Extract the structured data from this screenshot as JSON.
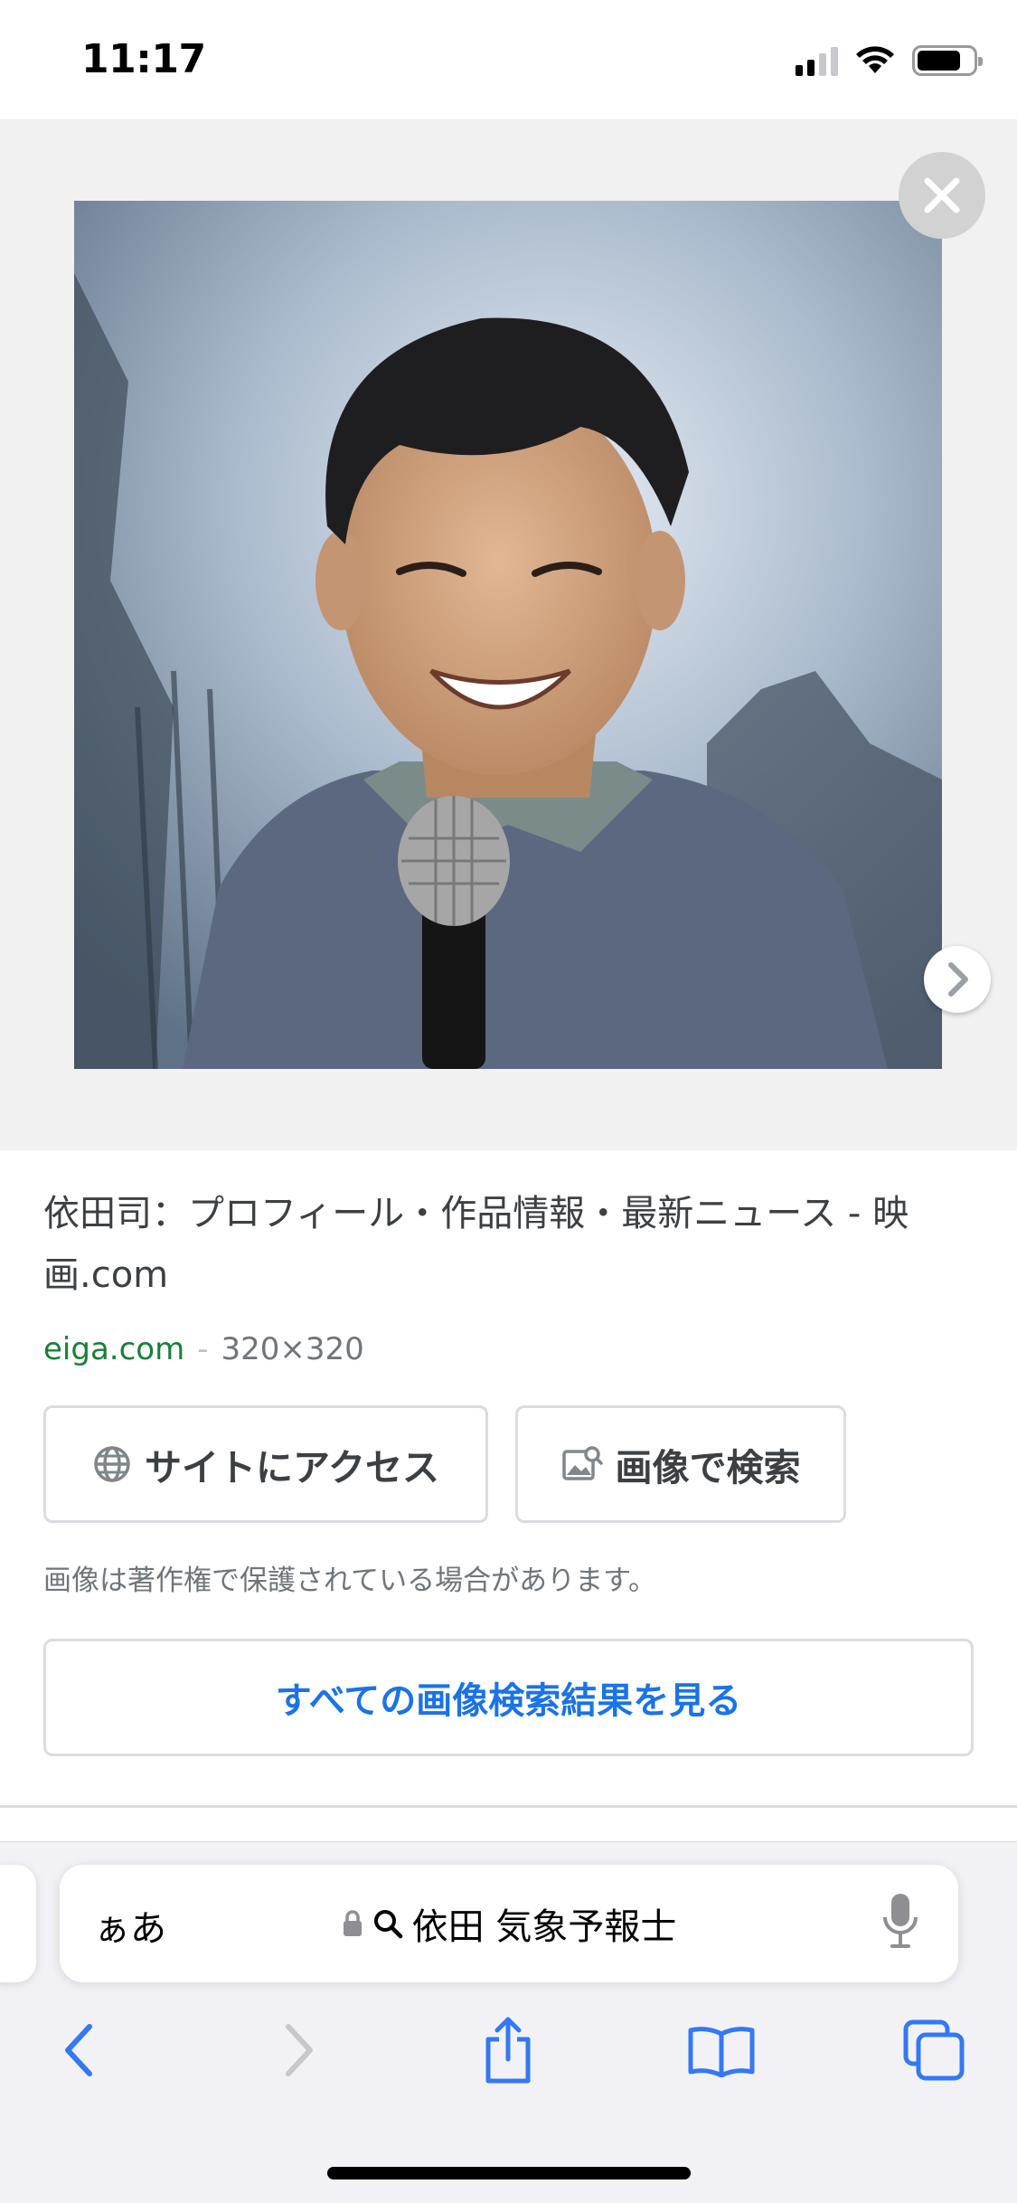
{
  "status_bar": {
    "time": "11:17"
  },
  "viewer": {
    "close_icon": "close-icon",
    "next_icon": "chevron-right-icon"
  },
  "result": {
    "title": "依田司：プロフィール・作品情報・最新ニュース - 映画.com",
    "domain": "eiga.com",
    "separator": "-",
    "dimensions": "320×320",
    "visit_label": "サイトにアクセス",
    "lens_label": "画像で検索",
    "copyright_notice": "画像は著作権で保護されている場合があります。",
    "see_all_label": "すべての画像検索結果を見る"
  },
  "browser": {
    "aa_label": "ぁあ",
    "url_text": "依田 気象予報士"
  },
  "colors": {
    "accent_blue": "#1a73e8",
    "domain_green": "#188038",
    "ios_blue": "#3478f6"
  }
}
